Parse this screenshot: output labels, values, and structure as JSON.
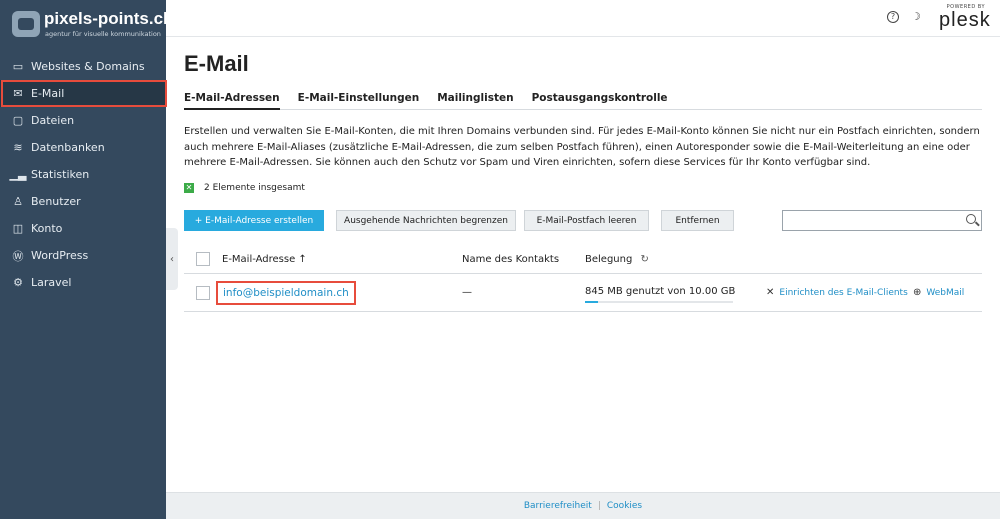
{
  "brand": {
    "name": "pixels-points.ch",
    "tagline": "agentur für visuelle kommunikation"
  },
  "sidebar": {
    "items": [
      {
        "label": "Websites & Domains",
        "icon": "monitor-icon"
      },
      {
        "label": "E-Mail",
        "icon": "envelope-icon",
        "active": true
      },
      {
        "label": "Dateien",
        "icon": "folder-icon"
      },
      {
        "label": "Datenbanken",
        "icon": "database-icon"
      },
      {
        "label": "Statistiken",
        "icon": "bar-chart-icon"
      },
      {
        "label": "Benutzer",
        "icon": "user-icon"
      },
      {
        "label": "Konto",
        "icon": "briefcase-icon"
      },
      {
        "label": "WordPress",
        "icon": "wordpress-icon"
      },
      {
        "label": "Laravel",
        "icon": "laravel-icon"
      }
    ],
    "collapse_glyph": "‹"
  },
  "header": {
    "help_glyph": "?",
    "theme_glyph": "☽",
    "powered_by": "POWERED BY",
    "plesk": "plesk"
  },
  "main": {
    "title": "E-Mail",
    "tabs": [
      {
        "label": "E-Mail-Adressen",
        "active": true
      },
      {
        "label": "E-Mail-Einstellungen"
      },
      {
        "label": "Mailinglisten"
      },
      {
        "label": "Postausgangskontrolle"
      }
    ],
    "description": "Erstellen und verwalten Sie E-Mail-Konten, die mit Ihren Domains verbunden sind. Für jedes E-Mail-Konto können Sie nicht nur ein Postfach einrichten, sondern auch mehrere E-Mail-Aliases (zusätzliche E-Mail-Adressen, die zum selben Postfach führen), einen Autoresponder sowie die E-Mail-Weiterleitung an eine oder mehrere E-Mail-Adressen. Sie können auch den Schutz vor Spam und Viren einrichten, sofern diese Services für Ihr Konto verfügbar sind.",
    "count_text": "2 Elemente insgesamt",
    "toolbar": {
      "create": "+ E-Mail-Adresse erstellen",
      "limit": "Ausgehende Nachrichten begrenzen",
      "empty": "E-Mail-Postfach leeren",
      "remove": "Entfernen",
      "search_placeholder": ""
    },
    "table": {
      "columns": {
        "email": "E-Mail-Adresse ↑",
        "contact": "Name des Kontakts",
        "usage": "Belegung"
      },
      "rows": [
        {
          "email": "info@beispieldomain.ch",
          "contact": "—",
          "usage": "845 MB genutzt von 10.00 GB",
          "usage_fraction": 0.0845,
          "setup_link": "Einrichten des E-Mail-Clients",
          "webmail_link": "WebMail"
        }
      ]
    }
  },
  "footer": {
    "accessibility": "Barrierefreiheit",
    "separator": "|",
    "cookies": "Cookies"
  },
  "colors": {
    "sidebar_bg": "#34495e",
    "primary": "#28aade",
    "link": "#1f8ec6",
    "highlight": "#e74c3c"
  }
}
